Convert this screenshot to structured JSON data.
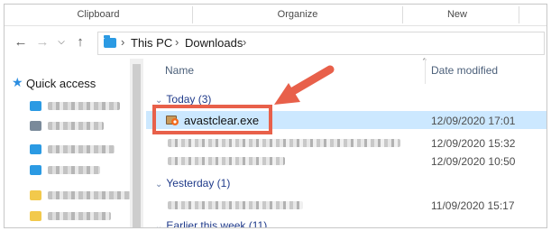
{
  "ribbon": {
    "groups": [
      "Clipboard",
      "Organize",
      "New"
    ]
  },
  "address": {
    "back_icon": "arrow-left-icon",
    "forward_icon": "arrow-right-icon",
    "recent_icon": "chevron-down-icon",
    "up_icon": "arrow-up-icon",
    "breadcrumb": [
      "This PC",
      "Downloads"
    ],
    "separator": "›"
  },
  "sidebar": {
    "quick_access": "Quick access",
    "star_icon": "star-icon"
  },
  "columns": {
    "name": "Name",
    "date_modified": "Date modified"
  },
  "groups": {
    "today": "Today (3)",
    "yesterday": "Yesterday (1)",
    "earlier": "Earlier this week (11)"
  },
  "files": {
    "today": [
      {
        "name": "avastclear.exe",
        "date": "12/09/2020 17:01",
        "selected": true,
        "icon": "avast-installer-icon"
      },
      {
        "name": "",
        "date": "12/09/2020 15:32",
        "selected": false
      },
      {
        "name": "",
        "date": "12/09/2020 10:50",
        "selected": false
      }
    ],
    "yesterday": [
      {
        "name": "",
        "date": "11/09/2020 15:17",
        "selected": false
      }
    ]
  },
  "colors": {
    "selection": "#cce8ff",
    "highlight": "#e8604a",
    "group_text": "#1f3a8a",
    "folder_blue": "#2b9ae3"
  }
}
